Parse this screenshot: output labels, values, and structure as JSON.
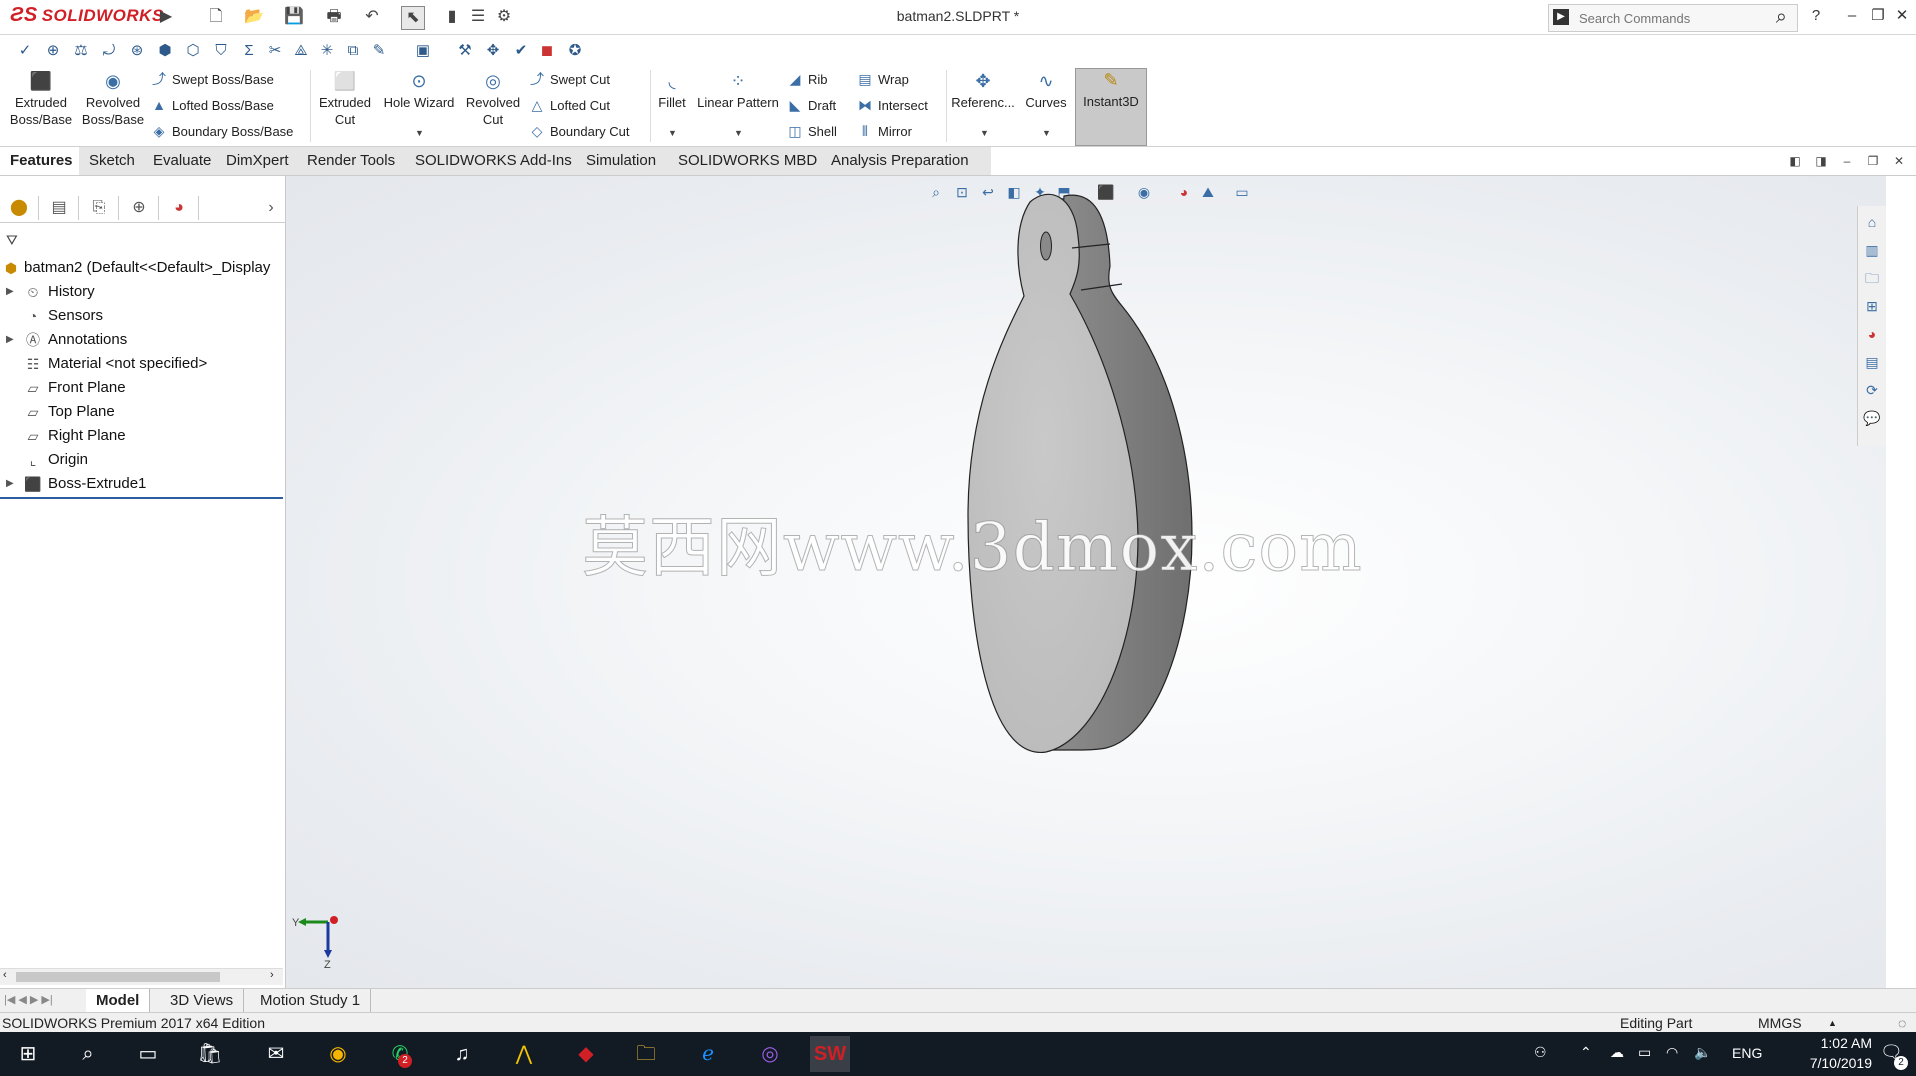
{
  "app": {
    "brand": "SOLIDWORKS",
    "file_title": "batman2.SLDPRT *"
  },
  "search": {
    "placeholder": "Search Commands"
  },
  "ribbon": {
    "extruded_boss": "Extruded Boss/Base",
    "revolved_boss": "Revolved Boss/Base",
    "swept_boss": "Swept Boss/Base",
    "lofted_boss": "Lofted Boss/Base",
    "boundary_boss": "Boundary Boss/Base",
    "extruded_cut": "Extruded Cut",
    "hole_wizard": "Hole Wizard",
    "revolved_cut": "Revolved Cut",
    "swept_cut": "Swept Cut",
    "lofted_cut": "Lofted Cut",
    "boundary_cut": "Boundary Cut",
    "fillet": "Fillet",
    "linear_pattern": "Linear Pattern",
    "rib": "Rib",
    "draft": "Draft",
    "shell": "Shell",
    "wrap": "Wrap",
    "intersect": "Intersect",
    "mirror": "Mirror",
    "reference": "Referenc...",
    "curves": "Curves",
    "instant3d": "Instant3D"
  },
  "tabs": [
    "Features",
    "Sketch",
    "Evaluate",
    "DimXpert",
    "Render Tools",
    "SOLIDWORKS Add-Ins",
    "Simulation",
    "SOLIDWORKS MBD",
    "Analysis Preparation"
  ],
  "tree": {
    "root": "batman2  (Default<<Default>_Display",
    "items": [
      "History",
      "Sensors",
      "Annotations",
      "Material <not specified>",
      "Front Plane",
      "Top Plane",
      "Right Plane",
      "Origin",
      "Boss-Extrude1"
    ]
  },
  "viewport": {
    "watermark": "莫西网www.3dmox.com",
    "triad_y": "Y",
    "triad_z": "Z"
  },
  "bottom_tabs": [
    "Model",
    "3D Views",
    "Motion Study 1"
  ],
  "status": {
    "edition": "SOLIDWORKS Premium 2017 x64 Edition",
    "mode": "Editing Part",
    "units": "MMGS"
  },
  "taskbar": {
    "lang": "ENG",
    "time": "1:02 AM",
    "date": "7/10/2019",
    "notif_count": "2",
    "whatsapp_badge": "2"
  },
  "colors": {
    "brand_red": "#d11f26",
    "accent_blue": "#3a6ea5",
    "taskbar_bg": "#121a24",
    "part_gray": "#c4c4c4"
  }
}
